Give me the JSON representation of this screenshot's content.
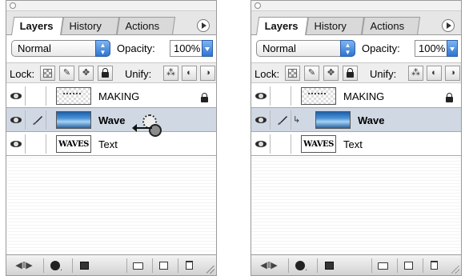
{
  "panels": [
    {
      "tabs": [
        "Layers",
        "History",
        "Actions"
      ],
      "blend_mode": "Normal",
      "opacity_label": "Opacity:",
      "opacity_value": "100%",
      "lock_label": "Lock:",
      "unify_label": "Unify:",
      "layers": [
        {
          "name": "MAKING",
          "selected": false,
          "locked": true
        },
        {
          "name": "Wave",
          "selected": true,
          "locked": false
        },
        {
          "name": "Text",
          "selected": false,
          "locked": false
        }
      ],
      "state": "dragging-into-clipping"
    },
    {
      "tabs": [
        "Layers",
        "History",
        "Actions"
      ],
      "blend_mode": "Normal",
      "opacity_label": "Opacity:",
      "opacity_value": "100%",
      "lock_label": "Lock:",
      "unify_label": "Unify:",
      "layers": [
        {
          "name": "MAKING",
          "selected": false,
          "locked": true
        },
        {
          "name": "Wave",
          "selected": true,
          "locked": false,
          "clipped": true
        },
        {
          "name": "Text",
          "selected": false,
          "locked": false
        }
      ],
      "state": "clipped"
    }
  ],
  "thumbnails": {
    "text_thumb_label": "WAVES"
  },
  "colors": {
    "selected_row": "#d0d8e4",
    "accent_blue": "#2f74d0"
  },
  "icons": [
    "eye-icon",
    "brush-icon",
    "lock-icon",
    "menu-arrow-icon",
    "trash-icon",
    "new-layer-icon",
    "folder-icon",
    "mask-icon",
    "adjustment-icon"
  ]
}
